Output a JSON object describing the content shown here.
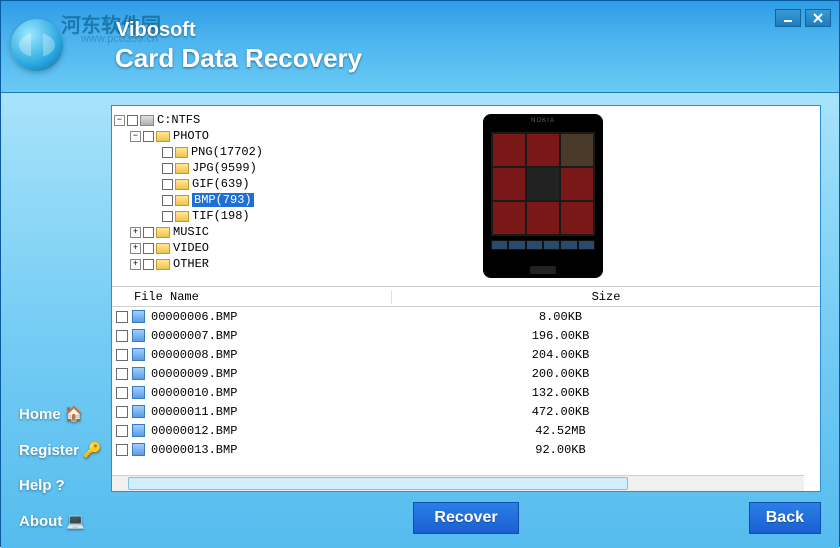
{
  "watermark": {
    "text": "河东软件园",
    "url": "www.pc0359.cn"
  },
  "app": {
    "title": "Vibosoft",
    "subtitle": "Card Data Recovery"
  },
  "tree": {
    "drive": "C:NTFS",
    "categories": [
      {
        "name": "PHOTO",
        "expanded": true,
        "children": [
          {
            "label": "PNG(17702)"
          },
          {
            "label": "JPG(9599)"
          },
          {
            "label": "GIF(639)"
          },
          {
            "label": "BMP(793)",
            "selected": true
          },
          {
            "label": "TIF(198)"
          }
        ]
      },
      {
        "name": "MUSIC",
        "expanded": false
      },
      {
        "name": "VIDEO",
        "expanded": false
      },
      {
        "name": "OTHER",
        "expanded": false
      }
    ]
  },
  "preview": {
    "device": "NOKIA"
  },
  "table": {
    "columns": {
      "name": "File Name",
      "size": "Size"
    },
    "rows": [
      {
        "name": "00000006.BMP",
        "size": "8.00KB"
      },
      {
        "name": "00000007.BMP",
        "size": "196.00KB"
      },
      {
        "name": "00000008.BMP",
        "size": "204.00KB"
      },
      {
        "name": "00000009.BMP",
        "size": "200.00KB"
      },
      {
        "name": "00000010.BMP",
        "size": "132.00KB"
      },
      {
        "name": "00000011.BMP",
        "size": "472.00KB"
      },
      {
        "name": "00000012.BMP",
        "size": "42.52MB"
      },
      {
        "name": "00000013.BMP",
        "size": "92.00KB"
      }
    ]
  },
  "sidebar": {
    "home": "Home",
    "register": "Register",
    "help": "Help",
    "about": "About"
  },
  "buttons": {
    "recover": "Recover",
    "back": "Back"
  }
}
